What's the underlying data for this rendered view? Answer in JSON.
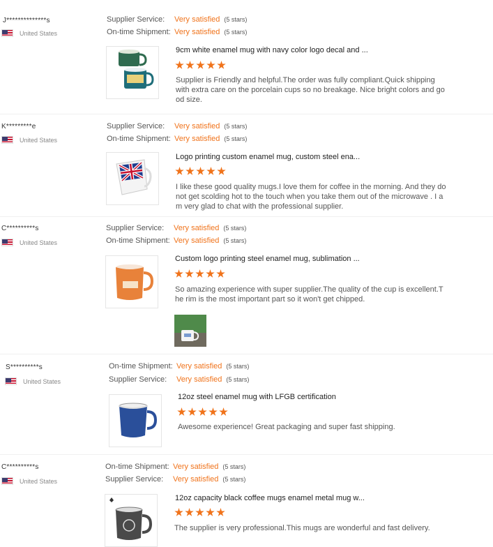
{
  "reviews": [
    {
      "buyer": "J**************s",
      "country": "United States",
      "rating1_label": "Supplier Service:",
      "rating1_value": "Very satisfied",
      "rating1_count": "(5 stars)",
      "rating2_label": "On-time Shipment:",
      "rating2_value": "Very satisfied",
      "rating2_count": "(5 stars)",
      "product_title": "9cm white enamel mug with navy color logo decal and ...",
      "stars": 5,
      "comment_lines": [
        "Supplier is Friendly and helpful.The order was fully compliant.Quick shipping",
        "with extra care on the porcelain cups so no breakage. Nice bright colors and go",
        "od size."
      ]
    },
    {
      "buyer": "K*********e",
      "country": "United States",
      "rating1_label": "Supplier Service:",
      "rating1_value": "Very satisfied",
      "rating1_count": "(5 stars)",
      "rating2_label": "On-time Shipment:",
      "rating2_value": "Very satisfied",
      "rating2_count": "(5 stars)",
      "product_title": "Logo printing custom enamel mug, custom steel ena...",
      "stars": 5,
      "comment_lines": [
        "I like these good quality mugs.I love them for coffee in the morning. And they do",
        "not get scolding hot to the touch when you take them out of the microwave . I a",
        "m very glad to chat with the professional supplier."
      ]
    },
    {
      "buyer": "C**********s",
      "country": "United States",
      "rating1_label": "Supplier Service:",
      "rating1_value": "Very satisfied",
      "rating1_count": "(5 stars)",
      "rating2_label": "On-time Shipment:",
      "rating2_value": "Very satisfied",
      "rating2_count": "(5 stars)",
      "product_title": "Custom logo printing steel enamel mug, sublimation ...",
      "stars": 5,
      "comment_lines": [
        "So amazing experience with super supplier.The quality of the cup is excellent.T",
        "he rim is the most important part so it won't get chipped."
      ]
    },
    {
      "buyer": "S**********s",
      "country": "United States",
      "rating1_label": "On-time Shipment:",
      "rating1_value": "Very satisfied",
      "rating1_count": "(5 stars)",
      "rating2_label": "Supplier Service:",
      "rating2_value": "Very satisfied",
      "rating2_count": "(5 stars)",
      "product_title": "12oz steel enamel mug with LFGB certification",
      "stars": 5,
      "comment_lines": [
        "Awesome experience! Great packaging and super fast shipping."
      ]
    },
    {
      "buyer": "C**********s",
      "country": "United States",
      "rating1_label": "On-time Shipment:",
      "rating1_value": "Very satisfied",
      "rating1_count": "(5 stars)",
      "rating2_label": "Supplier Service:",
      "rating2_value": "Very satisfied",
      "rating2_count": "(5 stars)",
      "product_title": "12oz capacity black coffee mugs enamel metal mug w...",
      "stars": 5,
      "comment_lines": [
        "The supplier is very professional.This mugs are wonderful and fast delivery."
      ]
    }
  ],
  "colors": {
    "accent": "#f0731b",
    "text": "#333333",
    "muted": "#888888"
  }
}
